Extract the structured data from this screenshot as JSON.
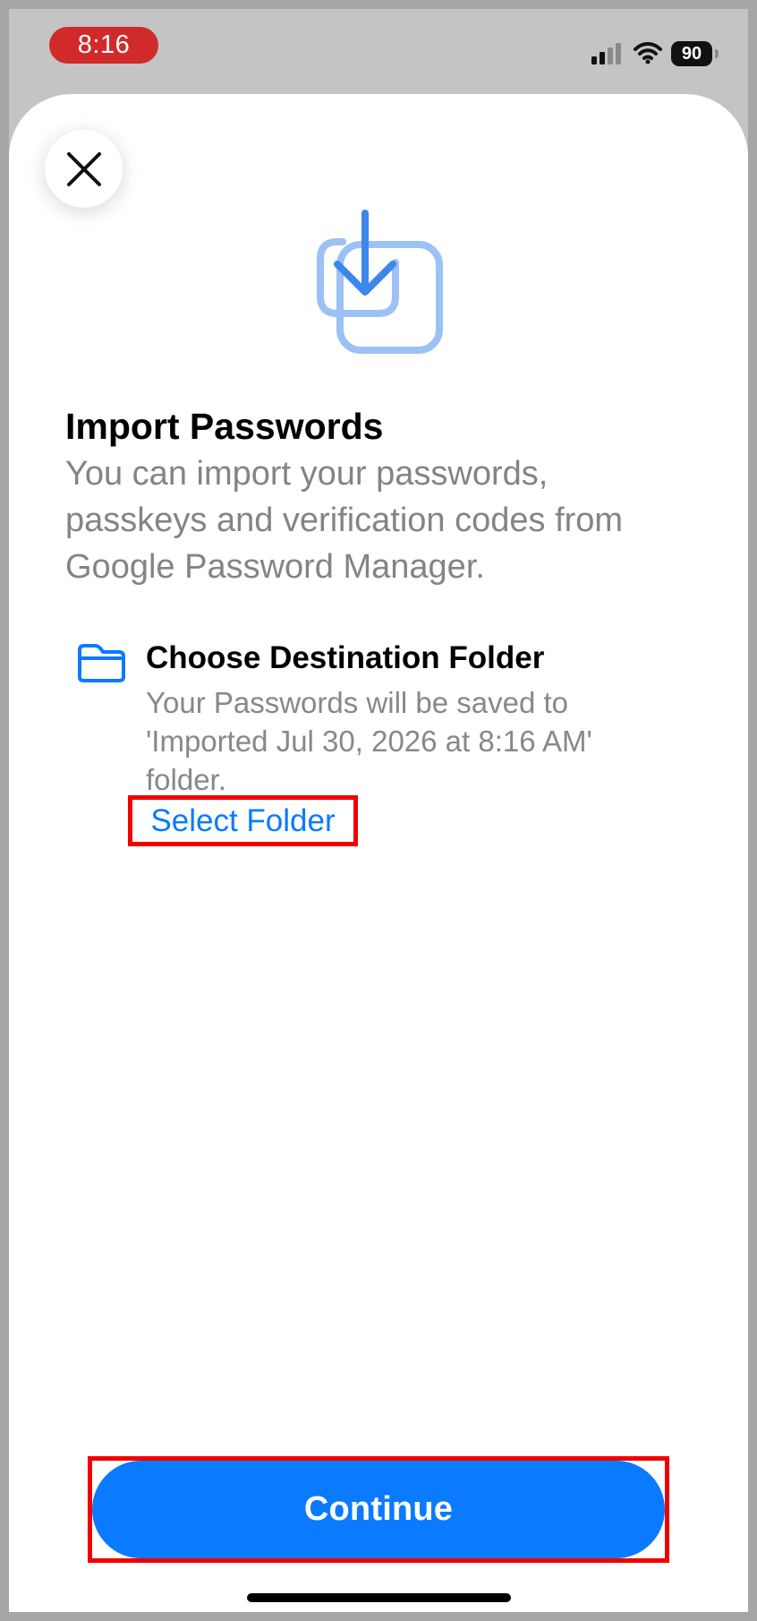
{
  "status_bar": {
    "time": "8:16",
    "battery": "90",
    "icons": [
      "cellular-signal-icon",
      "wifi-icon",
      "battery-icon"
    ]
  },
  "sheet": {
    "close_icon": "close-icon",
    "hero_icon": "import-download-icon",
    "title": "Import Passwords",
    "description": "You can import your passwords, passkeys and verification codes from Google Password Manager.",
    "folder_section": {
      "icon": "folder-icon",
      "title": "Choose Destination Folder",
      "line1": "Your Passwords will be saved to",
      "line2": "'Imported Jul 30, 2026 at 8:16 AM'",
      "line3": "folder.",
      "select_label": "Select Folder"
    },
    "continue_label": "Continue"
  },
  "colors": {
    "accent": "#0a7aff",
    "highlight": "#f00000",
    "secondary_text": "#848484",
    "icon_blue": "#3f86ea",
    "icon_light_blue": "#9cc1f6"
  }
}
